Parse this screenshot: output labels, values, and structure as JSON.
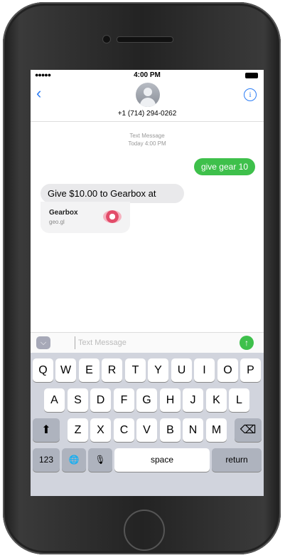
{
  "status": {
    "time": "4:00 PM"
  },
  "header": {
    "back_icon": "chevron-left-icon",
    "contact": "+1 (714) 294-0262",
    "info_icon": "info-icon"
  },
  "conversation": {
    "service": "Text Message",
    "timestamp": "Today 4:00 PM",
    "messages": [
      {
        "direction": "outgoing",
        "text": "give gear 10"
      },
      {
        "direction": "incoming",
        "text": "Give $10.00 to Gearbox at"
      }
    ],
    "link_card": {
      "title": "Gearbox",
      "subtitle": "geo.gl"
    }
  },
  "compose": {
    "placeholder": "Text Message",
    "apps_icon": "app-store-icon",
    "send_icon": "send-arrow-icon"
  },
  "keyboard": {
    "row1": [
      "Q",
      "W",
      "E",
      "R",
      "T",
      "Y",
      "U",
      "I",
      "O",
      "P"
    ],
    "row2": [
      "A",
      "S",
      "D",
      "F",
      "G",
      "H",
      "J",
      "K",
      "L"
    ],
    "row3": [
      "Z",
      "X",
      "C",
      "V",
      "B",
      "N",
      "M"
    ],
    "shift": "⬆",
    "delete": "⌫",
    "numbers": "123",
    "globe": "🌐",
    "mic": "🎙",
    "space": "space",
    "return": "return"
  },
  "colors": {
    "accent": "#2b7cf5",
    "imessage_green": "#3ec04b"
  }
}
